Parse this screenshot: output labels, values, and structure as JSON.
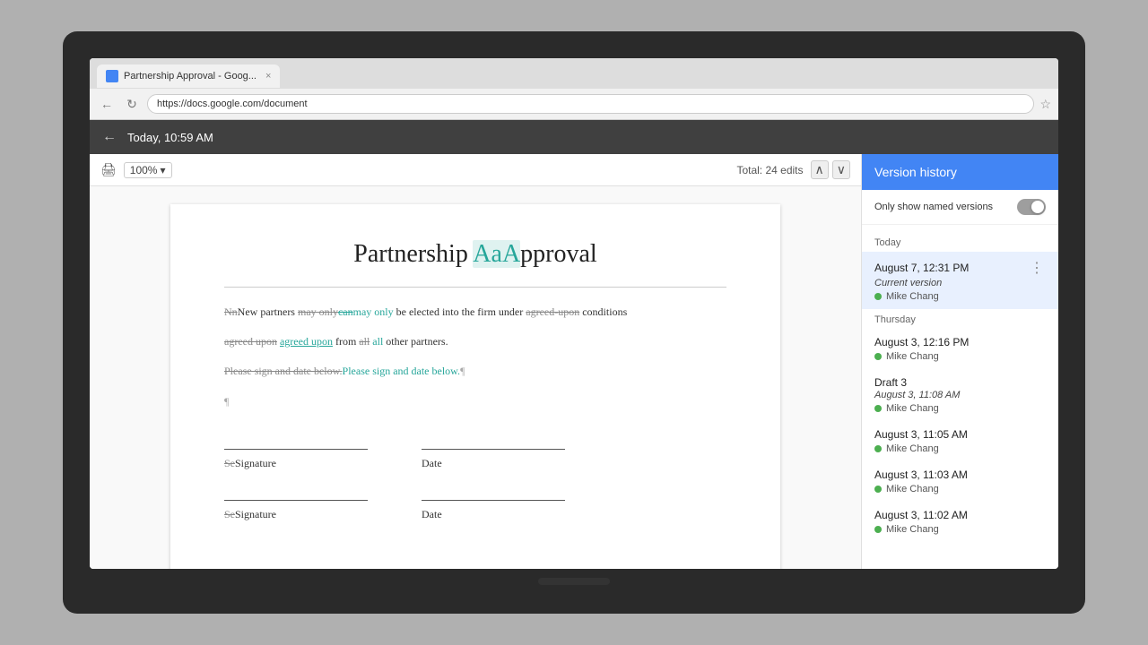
{
  "browser": {
    "tab_label": "Partnership Approval - Goog...",
    "tab_close": "×",
    "address": "https://docs.google.com/document",
    "star": "☆"
  },
  "doc_toolbar": {
    "back_arrow": "←",
    "title": "Today, 10:59 AM"
  },
  "secondary_toolbar": {
    "zoom": "100%",
    "zoom_arrow": "▾",
    "total_edits": "Total: 24 edits"
  },
  "document": {
    "title_part1": "Partnership ",
    "title_highlight": "AaA",
    "title_part2": "pproval",
    "body1_strikethrough1": "NnNew partners ",
    "body1_strike2": "may only",
    "body1_strike_link": "can",
    "body1_teal": "may only",
    "body1_rest": " be elected into the firm under ",
    "body1_strike3": "agreed-upon",
    "body1_end": " conditions",
    "body2": "agreed upon",
    "body2_link": "agreed upon",
    "body2_end": " from ",
    "body2_strike": "all",
    "body2_teal": "all",
    "body2_final": " other partners.",
    "body3_strike": "Please sign and date below.",
    "body3_teal": "Please sign and date below.",
    "para_mark": "¶",
    "sig_label1": "Signature",
    "sig_label1_strike": "Se",
    "date_label1": "Date",
    "sig_label2": "Signature",
    "sig_label2_strike": "Se",
    "date_label2": "Date"
  },
  "version_panel": {
    "title": "Version history",
    "toggle_label": "Only show named versions",
    "today_label": "Today",
    "thursday_label": "Thursday",
    "versions": [
      {
        "time": "August 7, 12:31 PM",
        "name": "Current version",
        "author": "Mike Chang",
        "active": true,
        "section": "today"
      },
      {
        "time": "August 3, 12:16 PM",
        "name": "",
        "author": "Mike Chang",
        "active": false,
        "section": "thursday"
      },
      {
        "time": "Draft 3",
        "name": "August 3, 11:08 AM",
        "author": "Mike Chang",
        "active": false,
        "section": "thursday"
      },
      {
        "time": "August 3, 11:05 AM",
        "name": "",
        "author": "Mike Chang",
        "active": false,
        "section": "thursday"
      },
      {
        "time": "August 3, 11:03 AM",
        "name": "",
        "author": "Mike Chang",
        "active": false,
        "section": "thursday"
      },
      {
        "time": "August 3, 11:02 AM",
        "name": "",
        "author": "Mike Chang",
        "active": false,
        "section": "thursday"
      }
    ]
  }
}
